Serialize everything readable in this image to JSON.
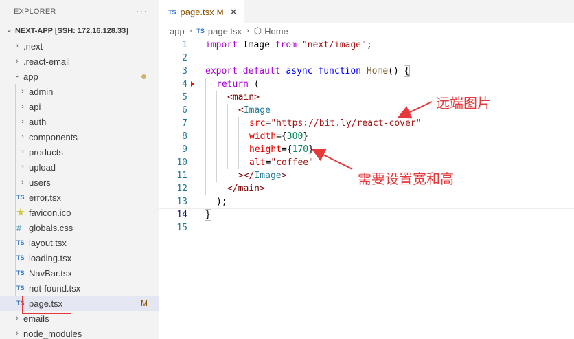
{
  "sidebar": {
    "title": "EXPLORER",
    "more": "···",
    "root": "NEXT-APP [SSH: 172.16.128.33]",
    "items": [
      {
        "label": ".next"
      },
      {
        "label": ".react-email"
      },
      {
        "label": "app"
      },
      {
        "label": "admin"
      },
      {
        "label": "api"
      },
      {
        "label": "auth"
      },
      {
        "label": "components"
      },
      {
        "label": "products"
      },
      {
        "label": "upload"
      },
      {
        "label": "users"
      },
      {
        "label": "error.tsx",
        "icon": "TS"
      },
      {
        "label": "favicon.ico",
        "icon": "★"
      },
      {
        "label": "globals.css",
        "icon": "#"
      },
      {
        "label": "layout.tsx",
        "icon": "TS"
      },
      {
        "label": "loading.tsx",
        "icon": "TS"
      },
      {
        "label": "NavBar.tsx",
        "icon": "TS"
      },
      {
        "label": "not-found.tsx",
        "icon": "TS"
      },
      {
        "label": "page.tsx",
        "icon": "TS",
        "status": "M"
      },
      {
        "label": "emails"
      },
      {
        "label": "node_modules"
      }
    ]
  },
  "editor": {
    "tab": {
      "icon": "TS",
      "label": "page.tsx",
      "status": "M",
      "close": "✕"
    },
    "breadcrumb": {
      "folder": "app",
      "file_icon": "TS",
      "file": "page.tsx",
      "symbol": "Home"
    },
    "line_numbers": [
      "1",
      "2",
      "3",
      "4",
      "5",
      "6",
      "7",
      "8",
      "9",
      "10",
      "11",
      "12",
      "13",
      "14",
      "15"
    ],
    "code": {
      "l1": [
        "import",
        " Image ",
        "from",
        " \"next/image\"",
        ";"
      ],
      "l3": [
        "export",
        " ",
        "default",
        " ",
        "async",
        " ",
        "function",
        " ",
        "Home",
        "() ",
        "{"
      ],
      "l4": [
        "return",
        " ("
      ],
      "l5": [
        "<",
        "main",
        ">"
      ],
      "l6": [
        "<",
        "Image"
      ],
      "l7": [
        "src",
        "=",
        "\"",
        "https://bit.ly/react-cover",
        "\""
      ],
      "l8": [
        "width",
        "={",
        "300",
        "}"
      ],
      "l9": [
        "height",
        "={",
        "170",
        "}"
      ],
      "l10": [
        "alt",
        "=",
        "\"coffee\""
      ],
      "l11": [
        "></",
        "Image",
        ">"
      ],
      "l12": [
        "</",
        "main",
        ">"
      ],
      "l13": [
        ");"
      ],
      "l14": [
        "}"
      ]
    }
  },
  "annotations": {
    "remote_image": "远端图片",
    "need_size": "需要设置宽和高"
  },
  "colors": {
    "annotation": "#e5393b",
    "keyword": "#0000ff",
    "control": "#af00db",
    "string": "#a31515",
    "tag": "#800000",
    "attribute": "#e50000",
    "number": "#098658"
  }
}
